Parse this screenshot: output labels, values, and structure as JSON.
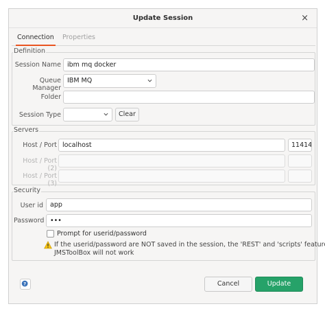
{
  "window": {
    "title": "Update Session",
    "close_glyph": "×"
  },
  "tabs": [
    {
      "label": "Connection",
      "active": true
    },
    {
      "label": "Properties",
      "active": false
    }
  ],
  "definition": {
    "group_title": "Definition",
    "session_name_label": "Session Name",
    "session_name_value": "ibm mq docker",
    "queue_manager_label": "Queue Manager",
    "queue_manager_value": "IBM MQ",
    "folder_label": "Folder",
    "folder_value": "",
    "session_type_label": "Session Type",
    "session_type_value": "",
    "clear_label": "Clear"
  },
  "servers": {
    "group_title": "Servers",
    "rows": [
      {
        "label": "Host / Port",
        "host": "localhost",
        "port": "11414",
        "enabled": true
      },
      {
        "label": "Host / Port (2)",
        "host": "",
        "port": "",
        "enabled": false
      },
      {
        "label": "Host / Port (3)",
        "host": "",
        "port": "",
        "enabled": false
      }
    ]
  },
  "security": {
    "group_title": "Security",
    "userid_label": "User id",
    "userid_value": "app",
    "password_label": "Password",
    "password_value": "•••",
    "prompt_label": "Prompt for userid/password",
    "prompt_checked": false,
    "warning_line1": "If the userid/password are NOT saved in the session, the 'REST' and 'scripts' features of",
    "warning_line2": "JMSToolBox will not work"
  },
  "footer": {
    "help_icon": "help-icon",
    "cancel_label": "Cancel",
    "update_label": "Update"
  },
  "colors": {
    "accent_tab": "#e95420",
    "update_button": "#26a269",
    "warning_icon": "#f5c211"
  }
}
